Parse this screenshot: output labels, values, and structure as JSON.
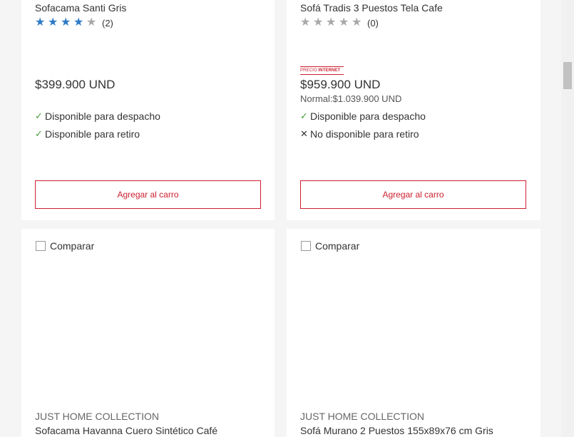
{
  "products": [
    {
      "title": "Sofacama Santi Gris",
      "rating_stars": 4,
      "review_count": "(2)",
      "price": "$399.900 UND",
      "despacho": "Disponible para despacho",
      "retiro": "Disponible para retiro",
      "cart_label": "Agregar al carro"
    },
    {
      "title": "Sofá Tradis 3 Puestos Tela Cafe",
      "rating_stars": 0,
      "review_count": "(0)",
      "badge_prefix": "PRECIO",
      "badge_strong": "INTERNET",
      "price": "$959.900 UND",
      "normal_price": "Normal:$1.039.900 UND",
      "despacho": "Disponible para despacho",
      "retiro": "No disponible para retiro",
      "cart_label": "Agregar al carro"
    },
    {
      "compare_label": "Comparar",
      "brand": "JUST HOME COLLECTION",
      "title": "Sofacama Havanna Cuero Sintético Café"
    },
    {
      "compare_label": "Comparar",
      "brand": "JUST HOME COLLECTION",
      "title": "Sofá Murano 2 Puestos 155x89x76 cm Gris"
    }
  ],
  "icons": {
    "star": "★",
    "check": "✓",
    "cross": "✕"
  },
  "colors": {
    "accent_red": "#cc2030",
    "star_blue": "#2e7bc6",
    "star_gray": "#a9a9a9",
    "check_green": "#4a9b3a"
  }
}
